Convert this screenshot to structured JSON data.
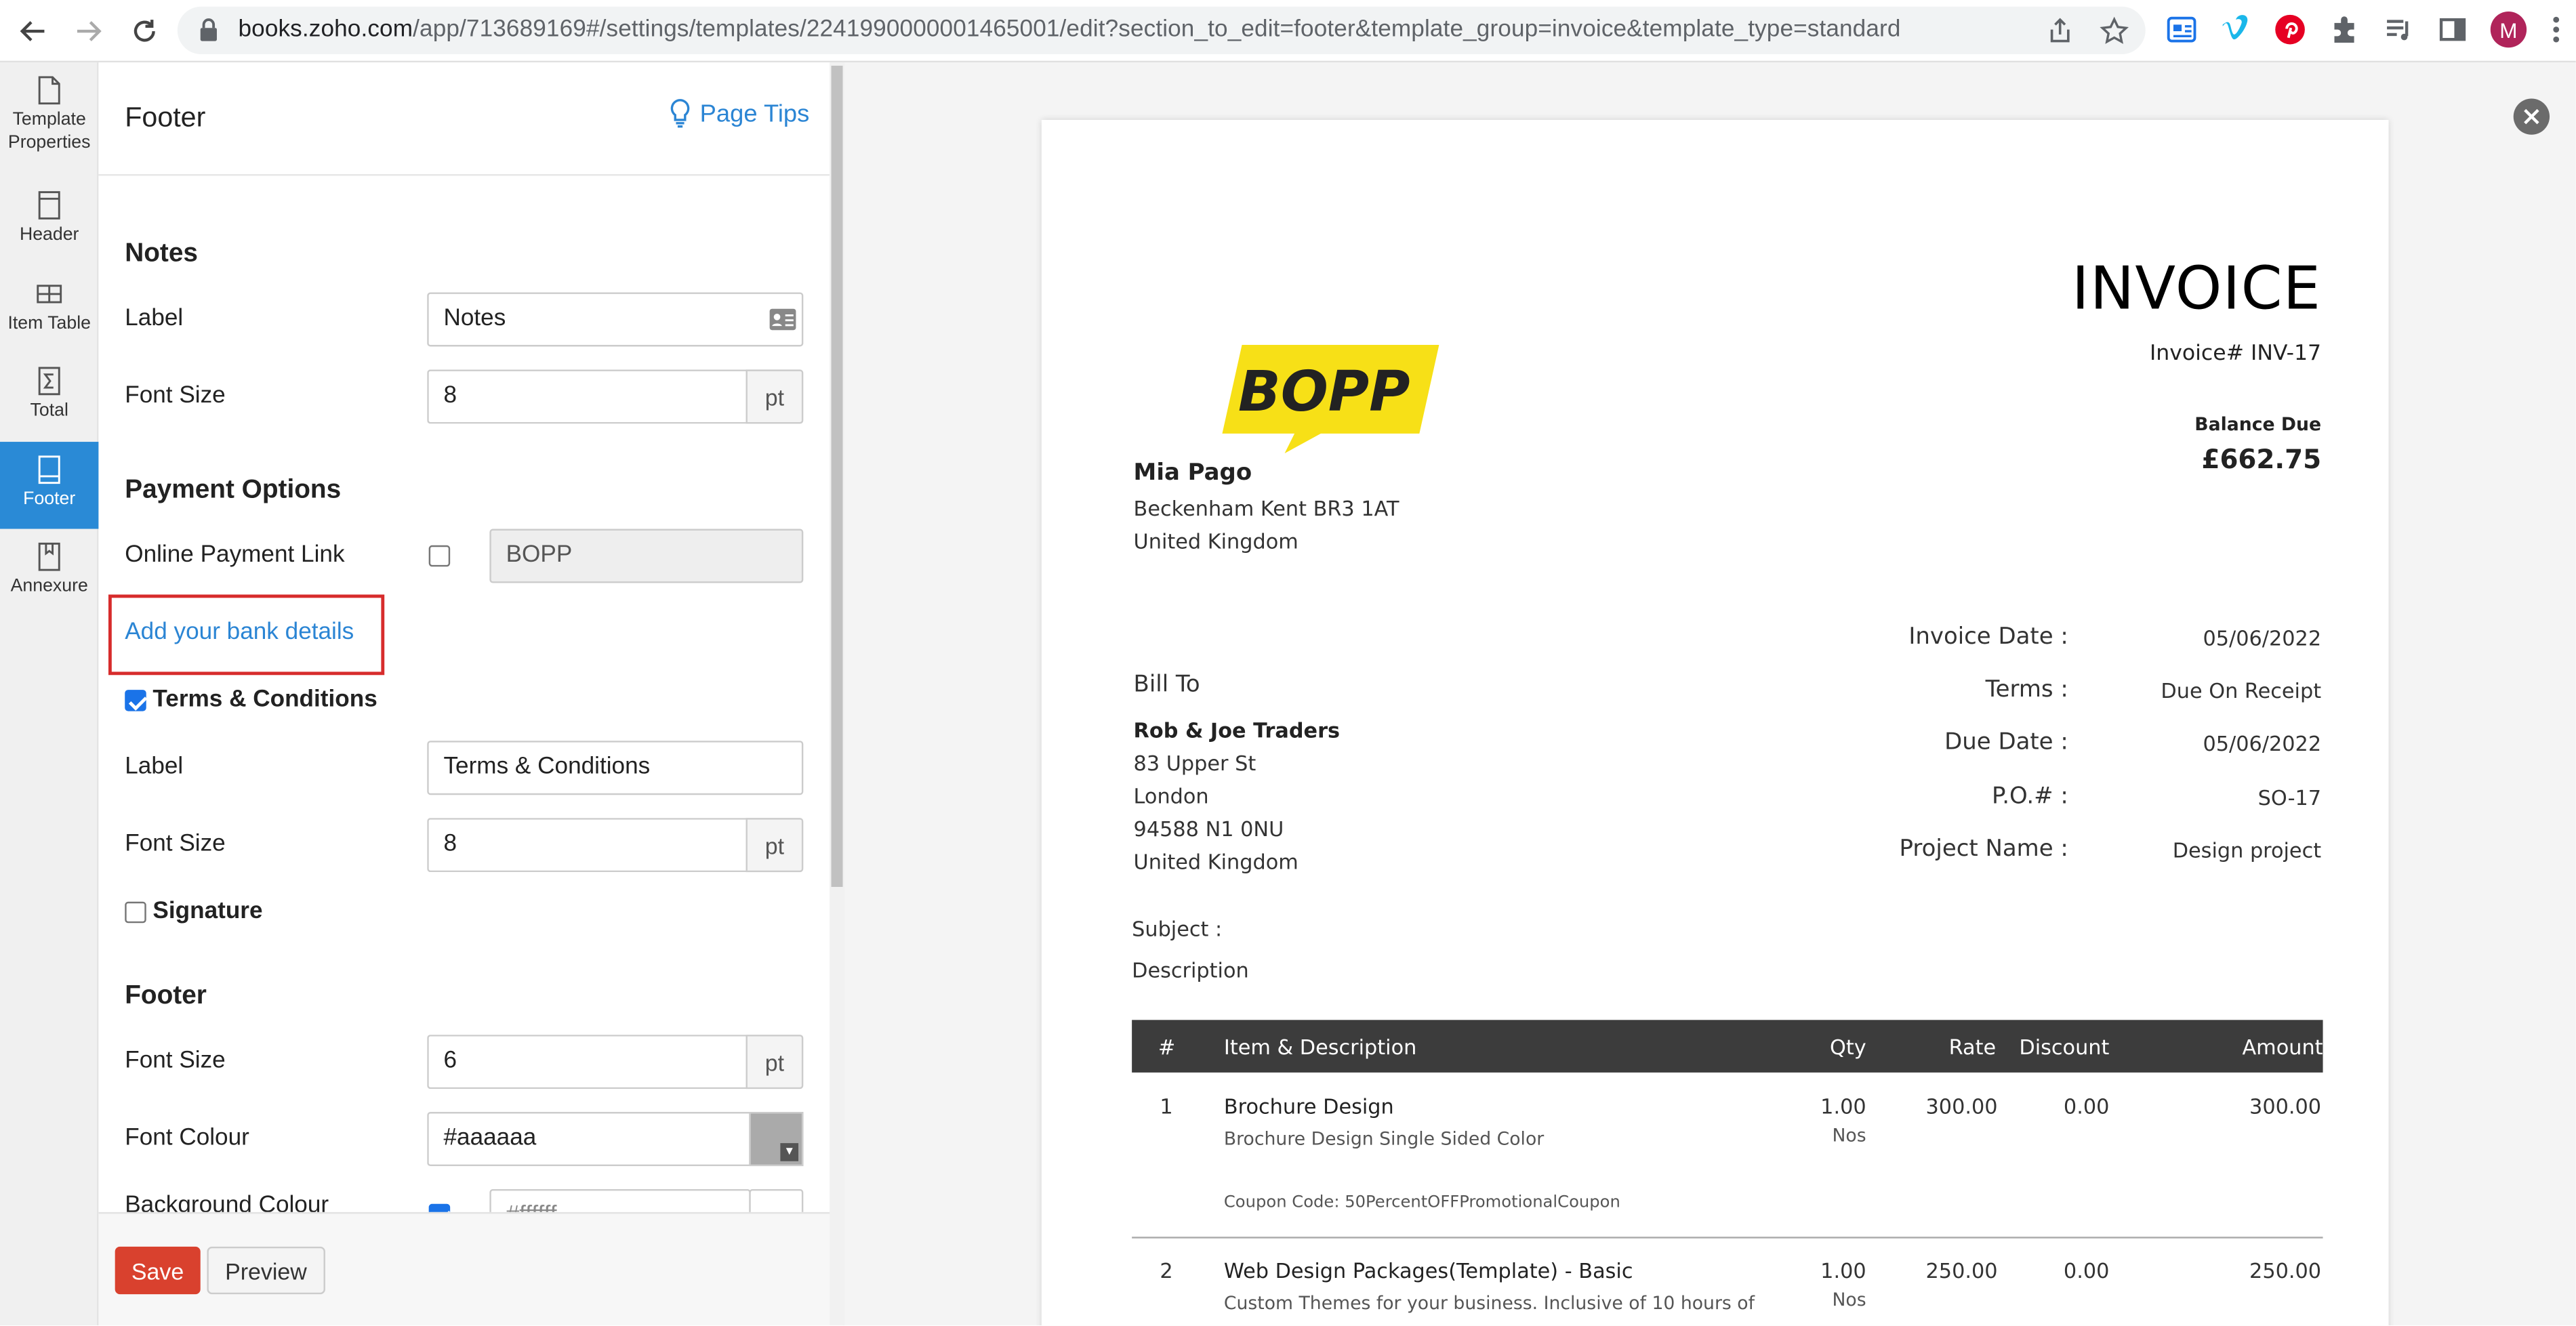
{
  "browser": {
    "url_host": "books.zoho.com",
    "url_path": "/app/713689169#/settings/templates/2241990000001465001/edit?section_to_edit=footer&template_group=invoice&template_type=standard",
    "profile_initial": "M",
    "colors": {
      "avatar": "#b0245a"
    }
  },
  "rail": {
    "items": [
      {
        "label_1": "Template",
        "label_2": "Properties",
        "icon": "page-icon"
      },
      {
        "label": "Header",
        "icon": "header-icon"
      },
      {
        "label": "Item Table",
        "icon": "table-icon"
      },
      {
        "label": "Total",
        "icon": "sigma-icon"
      },
      {
        "label": "Footer",
        "icon": "footer-icon",
        "active": true
      },
      {
        "label": "Annexure",
        "icon": "annexure-icon"
      }
    ]
  },
  "panel": {
    "title": "Footer",
    "page_tips": "Page Tips",
    "notes": {
      "section_title": "Notes",
      "label_caption": "Label",
      "label_value": "Notes",
      "font_size_caption": "Font Size",
      "font_size_value": "8",
      "unit": "pt"
    },
    "payment": {
      "section_title": "Payment Options",
      "online_link_caption": "Online Payment Link",
      "online_link_checked": false,
      "online_link_value": "BOPP",
      "bank_link": "Add your bank details"
    },
    "terms": {
      "checkbox_label": "Terms & Conditions",
      "checked": true,
      "label_caption": "Label",
      "label_value": "Terms & Conditions",
      "font_size_caption": "Font Size",
      "font_size_value": "8",
      "unit": "pt"
    },
    "signature": {
      "checkbox_label": "Signature",
      "checked": false
    },
    "footer": {
      "section_title": "Footer",
      "font_size_caption": "Font Size",
      "font_size_value": "6",
      "unit": "pt",
      "font_colour_caption": "Font Colour",
      "font_colour_value": "#aaaaaa",
      "background_caption": "Background Colour",
      "background_value": "#ffffff"
    },
    "buttons": {
      "save": "Save",
      "preview": "Preview"
    },
    "colors": {
      "accent": "#2a8ad6",
      "link": "#2b85d4",
      "save": "#d9412e",
      "highlight_box": "#d72c2c"
    }
  },
  "invoice": {
    "title": "INVOICE",
    "number_label": "Invoice# INV-17",
    "balance_due_label": "Balance Due",
    "balance_due_value": "£662.75",
    "logo_text": "BOPP",
    "logo_color": "#f7e017",
    "from": {
      "name": "Mia Pago",
      "line1": "Beckenham Kent BR3 1AT",
      "line2": "United Kingdom"
    },
    "bill_to_label": "Bill To",
    "bill_to": {
      "name": "Rob & Joe Traders",
      "line1": "83 Upper St",
      "line2": "London",
      "line3": "94588 N1 0NU",
      "line4": "United Kingdom"
    },
    "meta": [
      {
        "label": "Invoice Date :",
        "value": "05/06/2022"
      },
      {
        "label": "Terms :",
        "value": "Due On Receipt"
      },
      {
        "label": "Due Date :",
        "value": "05/06/2022"
      },
      {
        "label": "P.O.# :",
        "value": "SO-17"
      },
      {
        "label": "Project Name :",
        "value": "Design project"
      }
    ],
    "subject_label": "Subject :",
    "description_label": "Description",
    "table": {
      "headers": {
        "num": "#",
        "item": "Item & Description",
        "qty": "Qty",
        "rate": "Rate",
        "discount": "Discount",
        "amount": "Amount"
      },
      "rows": [
        {
          "num": "1",
          "item": "Brochure Design",
          "desc": "Brochure Design Single Sided Color",
          "coupon": "Coupon Code: 50PercentOFFPromotionalCoupon",
          "qty": "1.00",
          "unit": "Nos",
          "rate": "300.00",
          "discount": "0.00",
          "amount": "300.00"
        },
        {
          "num": "2",
          "item": "Web Design Packages(Template) - Basic",
          "desc": "Custom Themes for your business. Inclusive of 10 hours of",
          "qty": "1.00",
          "unit": "Nos",
          "rate": "250.00",
          "discount": "0.00",
          "amount": "250.00"
        }
      ]
    }
  }
}
